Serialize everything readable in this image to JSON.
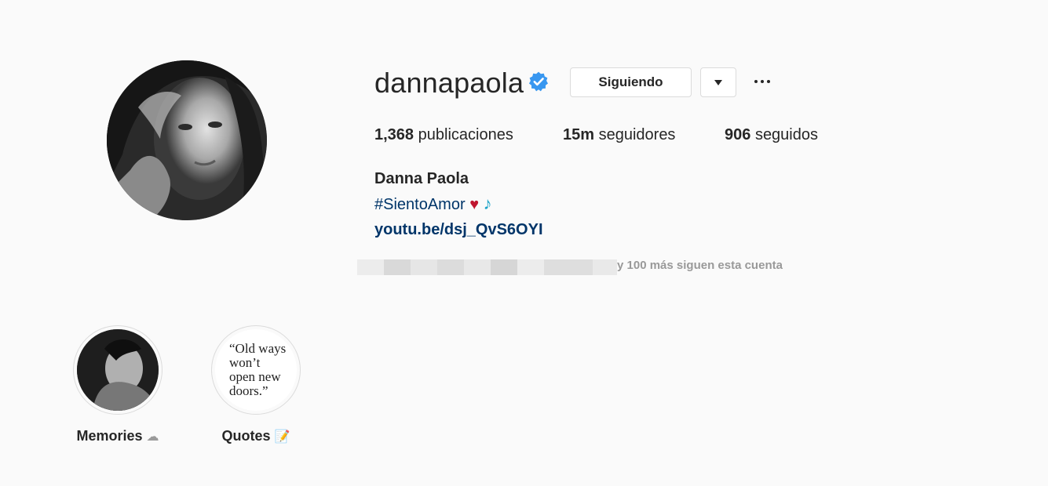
{
  "profile": {
    "username": "dannapaola",
    "verified": true,
    "verified_icon": "verified-badge-icon",
    "follow_button_label": "Siguiendo",
    "dropdown_icon": "caret-down-icon",
    "more_icon": "more-horizontal-icon",
    "avatar_icon": "profile-photo"
  },
  "stats": {
    "posts_count": "1,368",
    "posts_label": "publicaciones",
    "followers_count": "15m",
    "followers_label": "seguidores",
    "following_count": "906",
    "following_label": "seguidos"
  },
  "bio": {
    "full_name": "Danna Paola",
    "hashtag": "#SientoAmor",
    "heart": "♥",
    "music_note": "♪",
    "link": "youtu.be/dsj_QvS6OYI"
  },
  "followed_by": {
    "text": "y 100 más siguen esta cuenta"
  },
  "highlights": [
    {
      "label": "Memories",
      "emoji": "☁"
    },
    {
      "label": "Quotes",
      "emoji": "📝",
      "quote_lines": [
        "“Old ways",
        "won’t",
        "open new",
        "doors.”"
      ]
    }
  ],
  "colors": {
    "background": "#fafafa",
    "link": "#003569",
    "verified": "#3897f0",
    "border": "#dbdbdb"
  }
}
